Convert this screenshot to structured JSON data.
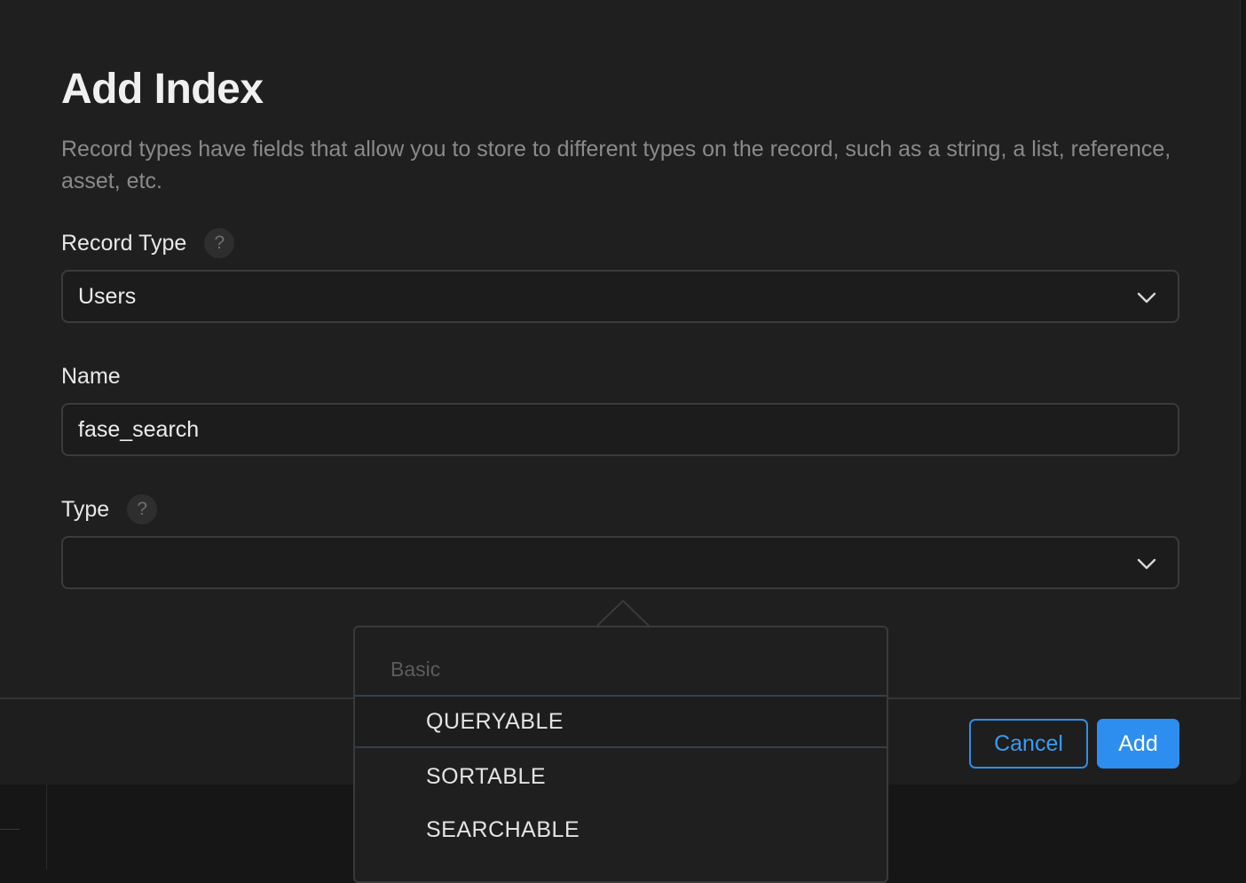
{
  "dialog": {
    "title": "Add Index",
    "description": "Record types have fields that allow you to store to different types on the record, such as a string, a list, reference, asset, etc."
  },
  "record_type": {
    "label": "Record Type",
    "help_glyph": "?",
    "selected": "Users"
  },
  "name": {
    "label": "Name",
    "value": "fase_search"
  },
  "type": {
    "label": "Type",
    "help_glyph": "?",
    "selected": ""
  },
  "dropdown": {
    "section_label": "Basic",
    "options": [
      "QUERYABLE",
      "SORTABLE",
      "SEARCHABLE"
    ],
    "highlighted_index": 0
  },
  "footer": {
    "cancel_label": "Cancel",
    "add_label": "Add"
  },
  "colors": {
    "accent": "#2d8ef0",
    "dialog_bg": "#1f1f1f",
    "border": "#3b3b3b"
  }
}
